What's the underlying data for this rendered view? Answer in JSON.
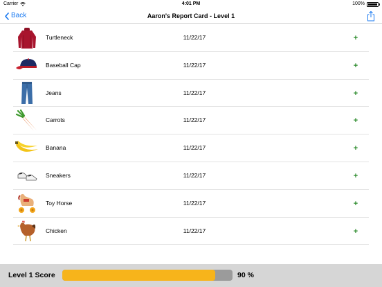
{
  "status_bar": {
    "carrier": "Carrier",
    "time": "4:01 PM",
    "battery": "100%"
  },
  "nav": {
    "back_label": "Back",
    "title": "Aaron's Report Card - Level 1",
    "accent_color": "#1677f0"
  },
  "items": [
    {
      "name": "Turtleneck",
      "date": "11/22/17",
      "action": "+",
      "icon": "turtleneck-icon"
    },
    {
      "name": "Baseball Cap",
      "date": "11/22/17",
      "action": "+",
      "icon": "baseball-cap-icon"
    },
    {
      "name": "Jeans",
      "date": "11/22/17",
      "action": "+",
      "icon": "jeans-icon"
    },
    {
      "name": "Carrots",
      "date": "11/22/17",
      "action": "+",
      "icon": "carrots-icon"
    },
    {
      "name": "Banana",
      "date": "11/22/17",
      "action": "+",
      "icon": "banana-icon"
    },
    {
      "name": "Sneakers",
      "date": "11/22/17",
      "action": "+",
      "icon": "sneakers-icon"
    },
    {
      "name": "Toy Horse",
      "date": "11/22/17",
      "action": "+",
      "icon": "toy-horse-icon"
    },
    {
      "name": "Chicken",
      "date": "11/22/17",
      "action": "+",
      "icon": "chicken-icon"
    }
  ],
  "footer": {
    "score_label": "Level 1 Score",
    "score_text": "90 %",
    "score_fraction": 0.9,
    "fill_color": "#f7b41b"
  }
}
